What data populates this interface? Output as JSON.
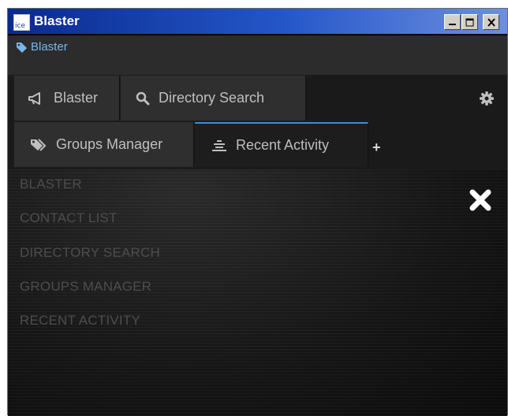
{
  "window": {
    "icon_text": "ice",
    "title": "Blaster"
  },
  "subbar": {
    "label": "Blaster"
  },
  "tabs": [
    {
      "label": "Blaster",
      "icon": "megaphone-icon"
    },
    {
      "label": "Directory Search",
      "icon": "search-icon"
    },
    {
      "label": "Groups Manager",
      "icon": "tags-icon"
    },
    {
      "label": "Recent Activity",
      "icon": "list-icon",
      "active": true
    }
  ],
  "add_tab": "+",
  "menu": {
    "items": [
      "BLASTER",
      "CONTACT LIST",
      "DIRECTORY SEARCH",
      "GROUPS MANAGER",
      "RECENT ACTIVITY"
    ]
  },
  "colors": {
    "accent": "#3b8fd6",
    "link": "#7bb6ea",
    "menu_text": "#4d4d4d"
  }
}
